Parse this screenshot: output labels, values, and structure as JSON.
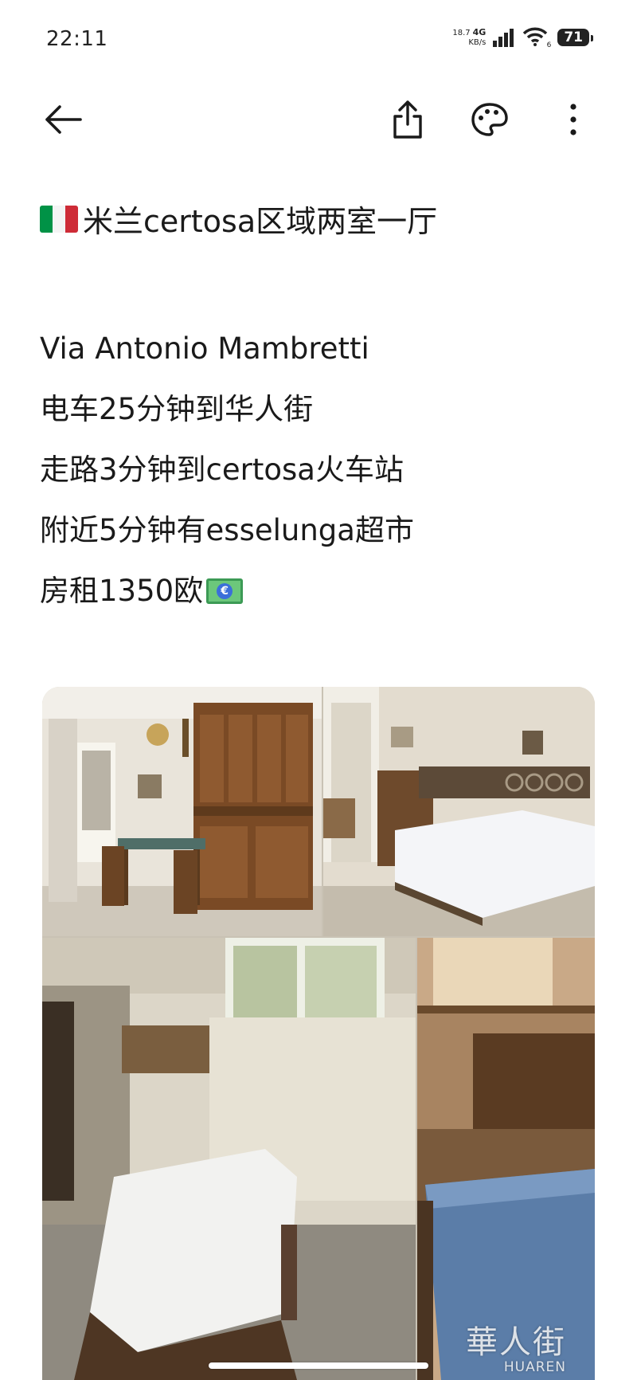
{
  "status_bar": {
    "time": "22:11",
    "net_speed_value": "18.7",
    "net_speed_unit": "KB/s",
    "network_type": "4G",
    "wifi_badge": "6",
    "battery": "71"
  },
  "toolbar": {
    "back_icon": "arrow-left-icon",
    "share_icon": "share-icon",
    "theme_icon": "palette-icon",
    "more_icon": "more-vertical-icon"
  },
  "note": {
    "title_flag": "italy-flag",
    "title": "米兰certosa区域两室一厅",
    "lines": [
      "Via Antonio Mambretti",
      "电车25分钟到华人街",
      "走路3分钟到certosa火车站",
      "附近5分钟有esselunga超市",
      "房租1350欧"
    ],
    "money_icon": "euro-banknote-icon"
  },
  "photos": {
    "items": [
      "living-room",
      "bedroom-double",
      "bedroom-single",
      "bedroom-single-2"
    ],
    "watermark_cn": "華人街",
    "watermark_en": "HUAREN"
  },
  "colors": {
    "flag_green": "#009246",
    "flag_white": "#ffffff",
    "flag_red": "#ce2b37",
    "money_green": "#6cc77b"
  }
}
